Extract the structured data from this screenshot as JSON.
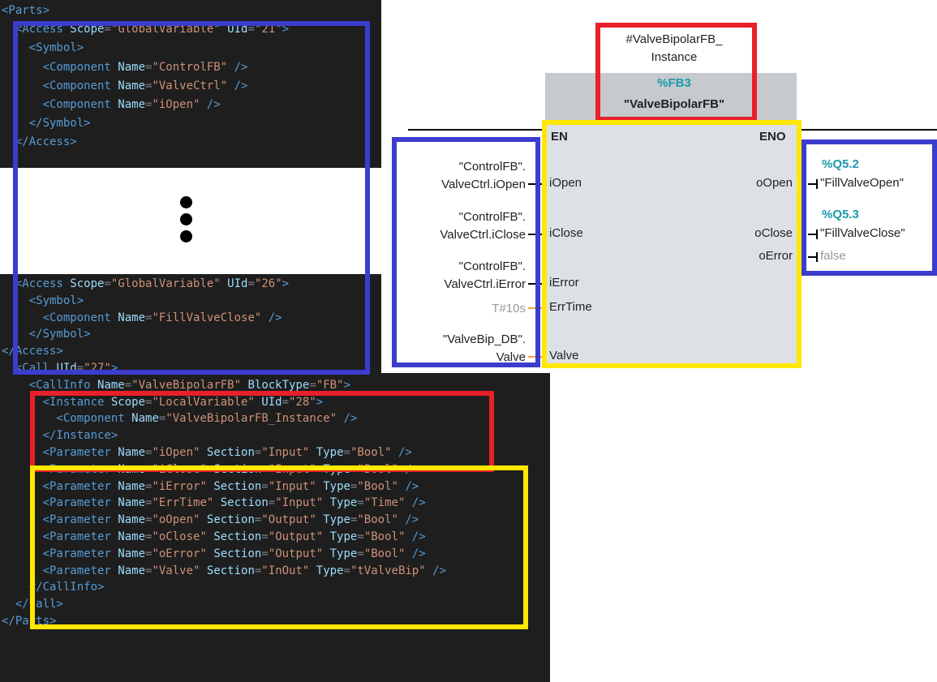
{
  "xml_top": {
    "lines": [
      [
        {
          "c": "t",
          "v": "<Parts>"
        }
      ],
      [
        {
          "c": "t",
          "v": "  <Access "
        },
        {
          "c": "a",
          "v": "Scope"
        },
        {
          "c": "p",
          "v": "="
        },
        {
          "c": "s",
          "v": "\"GlobalVariable\""
        },
        {
          "c": "a",
          "v": " UId"
        },
        {
          "c": "p",
          "v": "="
        },
        {
          "c": "s",
          "v": "\"21\""
        },
        {
          "c": "t",
          "v": ">"
        }
      ],
      [
        {
          "c": "t",
          "v": "    <Symbol>"
        }
      ],
      [
        {
          "c": "t",
          "v": "      <Component "
        },
        {
          "c": "a",
          "v": "Name"
        },
        {
          "c": "p",
          "v": "="
        },
        {
          "c": "s",
          "v": "\"ControlFB\""
        },
        {
          "c": "t",
          "v": " />"
        }
      ],
      [
        {
          "c": "t",
          "v": "      <Component "
        },
        {
          "c": "a",
          "v": "Name"
        },
        {
          "c": "p",
          "v": "="
        },
        {
          "c": "s",
          "v": "\"ValveCtrl\""
        },
        {
          "c": "t",
          "v": " />"
        }
      ],
      [
        {
          "c": "t",
          "v": "      <Component "
        },
        {
          "c": "a",
          "v": "Name"
        },
        {
          "c": "p",
          "v": "="
        },
        {
          "c": "s",
          "v": "\"iOpen\""
        },
        {
          "c": "t",
          "v": " />"
        }
      ],
      [
        {
          "c": "t",
          "v": "    </Symbol>"
        }
      ],
      [
        {
          "c": "t",
          "v": "  </Access>"
        }
      ]
    ]
  },
  "xml_bottom": {
    "lines": [
      [
        {
          "c": "t",
          "v": "  <Access "
        },
        {
          "c": "a",
          "v": "Scope"
        },
        {
          "c": "p",
          "v": "="
        },
        {
          "c": "s",
          "v": "\"GlobalVariable\""
        },
        {
          "c": "a",
          "v": " UId"
        },
        {
          "c": "p",
          "v": "="
        },
        {
          "c": "s",
          "v": "\"26\""
        },
        {
          "c": "t",
          "v": ">"
        }
      ],
      [
        {
          "c": "t",
          "v": "    <Symbol>"
        }
      ],
      [
        {
          "c": "t",
          "v": "      <Component "
        },
        {
          "c": "a",
          "v": "Name"
        },
        {
          "c": "p",
          "v": "="
        },
        {
          "c": "s",
          "v": "\"FillValveClose\""
        },
        {
          "c": "t",
          "v": " />"
        }
      ],
      [
        {
          "c": "t",
          "v": "    </Symbol>"
        }
      ],
      [
        {
          "c": "t",
          "v": "</Access>"
        }
      ],
      [
        {
          "c": "t",
          "v": "  <Call "
        },
        {
          "c": "a",
          "v": "UId"
        },
        {
          "c": "p",
          "v": "="
        },
        {
          "c": "s",
          "v": "\"27\""
        },
        {
          "c": "t",
          "v": ">"
        }
      ],
      [
        {
          "c": "t",
          "v": "    <CallInfo "
        },
        {
          "c": "a",
          "v": "Name"
        },
        {
          "c": "p",
          "v": "="
        },
        {
          "c": "s",
          "v": "\"ValveBipolarFB\""
        },
        {
          "c": "a",
          "v": " BlockType"
        },
        {
          "c": "p",
          "v": "="
        },
        {
          "c": "s",
          "v": "\"FB\""
        },
        {
          "c": "t",
          "v": ">"
        }
      ],
      [
        {
          "c": "t",
          "v": "      <Instance "
        },
        {
          "c": "a",
          "v": "Scope"
        },
        {
          "c": "p",
          "v": "="
        },
        {
          "c": "s",
          "v": "\"LocalVariable\""
        },
        {
          "c": "a",
          "v": " UId"
        },
        {
          "c": "p",
          "v": "="
        },
        {
          "c": "s",
          "v": "\"28\""
        },
        {
          "c": "t",
          "v": ">"
        }
      ],
      [
        {
          "c": "t",
          "v": "        <Component "
        },
        {
          "c": "a",
          "v": "Name"
        },
        {
          "c": "p",
          "v": "="
        },
        {
          "c": "s",
          "v": "\"ValveBipolarFB_Instance\""
        },
        {
          "c": "t",
          "v": " />"
        }
      ],
      [
        {
          "c": "t",
          "v": "      </Instance>"
        }
      ],
      [
        {
          "c": "t",
          "v": "      <Parameter "
        },
        {
          "c": "a",
          "v": "Name"
        },
        {
          "c": "p",
          "v": "="
        },
        {
          "c": "s",
          "v": "\"iOpen\""
        },
        {
          "c": "a",
          "v": " Section"
        },
        {
          "c": "p",
          "v": "="
        },
        {
          "c": "s",
          "v": "\"Input\""
        },
        {
          "c": "a",
          "v": " Type"
        },
        {
          "c": "p",
          "v": "="
        },
        {
          "c": "s",
          "v": "\"Bool\""
        },
        {
          "c": "t",
          "v": " />"
        }
      ],
      [
        {
          "c": "t",
          "v": "      <Parameter "
        },
        {
          "c": "a",
          "v": "Name"
        },
        {
          "c": "p",
          "v": "="
        },
        {
          "c": "s",
          "v": "\"iClose\""
        },
        {
          "c": "a",
          "v": " Section"
        },
        {
          "c": "p",
          "v": "="
        },
        {
          "c": "s",
          "v": "\"Input\""
        },
        {
          "c": "a",
          "v": " Type"
        },
        {
          "c": "p",
          "v": "="
        },
        {
          "c": "s",
          "v": "\"Bool\""
        },
        {
          "c": "t",
          "v": " />"
        }
      ],
      [
        {
          "c": "t",
          "v": "      <Parameter "
        },
        {
          "c": "a",
          "v": "Name"
        },
        {
          "c": "p",
          "v": "="
        },
        {
          "c": "s",
          "v": "\"iError\""
        },
        {
          "c": "a",
          "v": " Section"
        },
        {
          "c": "p",
          "v": "="
        },
        {
          "c": "s",
          "v": "\"Input\""
        },
        {
          "c": "a",
          "v": " Type"
        },
        {
          "c": "p",
          "v": "="
        },
        {
          "c": "s",
          "v": "\"Bool\""
        },
        {
          "c": "t",
          "v": " />"
        }
      ],
      [
        {
          "c": "t",
          "v": "      <Parameter "
        },
        {
          "c": "a",
          "v": "Name"
        },
        {
          "c": "p",
          "v": "="
        },
        {
          "c": "s",
          "v": "\"ErrTime\""
        },
        {
          "c": "a",
          "v": " Section"
        },
        {
          "c": "p",
          "v": "="
        },
        {
          "c": "s",
          "v": "\"Input\""
        },
        {
          "c": "a",
          "v": " Type"
        },
        {
          "c": "p",
          "v": "="
        },
        {
          "c": "s",
          "v": "\"Time\""
        },
        {
          "c": "t",
          "v": " />"
        }
      ],
      [
        {
          "c": "t",
          "v": "      <Parameter "
        },
        {
          "c": "a",
          "v": "Name"
        },
        {
          "c": "p",
          "v": "="
        },
        {
          "c": "s",
          "v": "\"oOpen\""
        },
        {
          "c": "a",
          "v": " Section"
        },
        {
          "c": "p",
          "v": "="
        },
        {
          "c": "s",
          "v": "\"Output\""
        },
        {
          "c": "a",
          "v": " Type"
        },
        {
          "c": "p",
          "v": "="
        },
        {
          "c": "s",
          "v": "\"Bool\""
        },
        {
          "c": "t",
          "v": " />"
        }
      ],
      [
        {
          "c": "t",
          "v": "      <Parameter "
        },
        {
          "c": "a",
          "v": "Name"
        },
        {
          "c": "p",
          "v": "="
        },
        {
          "c": "s",
          "v": "\"oClose\""
        },
        {
          "c": "a",
          "v": " Section"
        },
        {
          "c": "p",
          "v": "="
        },
        {
          "c": "s",
          "v": "\"Output\""
        },
        {
          "c": "a",
          "v": " Type"
        },
        {
          "c": "p",
          "v": "="
        },
        {
          "c": "s",
          "v": "\"Bool\""
        },
        {
          "c": "t",
          "v": " />"
        }
      ],
      [
        {
          "c": "t",
          "v": "      <Parameter "
        },
        {
          "c": "a",
          "v": "Name"
        },
        {
          "c": "p",
          "v": "="
        },
        {
          "c": "s",
          "v": "\"oError\""
        },
        {
          "c": "a",
          "v": " Section"
        },
        {
          "c": "p",
          "v": "="
        },
        {
          "c": "s",
          "v": "\"Output\""
        },
        {
          "c": "a",
          "v": " Type"
        },
        {
          "c": "p",
          "v": "="
        },
        {
          "c": "s",
          "v": "\"Bool\""
        },
        {
          "c": "t",
          "v": " />"
        }
      ],
      [
        {
          "c": "t",
          "v": "      <Parameter "
        },
        {
          "c": "a",
          "v": "Name"
        },
        {
          "c": "p",
          "v": "="
        },
        {
          "c": "s",
          "v": "\"Valve\""
        },
        {
          "c": "a",
          "v": " Section"
        },
        {
          "c": "p",
          "v": "="
        },
        {
          "c": "s",
          "v": "\"InOut\""
        },
        {
          "c": "a",
          "v": " Type"
        },
        {
          "c": "p",
          "v": "="
        },
        {
          "c": "s",
          "v": "\"tValveBip\""
        },
        {
          "c": "t",
          "v": " />"
        }
      ],
      [
        {
          "c": "t",
          "v": "    </CallInfo>"
        }
      ],
      [
        {
          "c": "t",
          "v": "  </Call>"
        }
      ],
      [
        {
          "c": "t",
          "v": "</Parts>"
        }
      ]
    ]
  },
  "fbd": {
    "instance_name": "#ValveBipolarFB_\nInstance",
    "address": "%FB3",
    "block_name": "\"ValveBipolarFB\"",
    "en": "EN",
    "eno": "ENO",
    "inputs": [
      {
        "pin": "iOpen",
        "arg": "\"ControlFB\".\nValveCtrl.iOpen",
        "wire": "black"
      },
      {
        "pin": "iClose",
        "arg": "\"ControlFB\".\nValveCtrl.iClose",
        "wire": "black"
      },
      {
        "pin": "iError",
        "arg": "\"ControlFB\".\nValveCtrl.iError",
        "wire": "black"
      },
      {
        "pin": "ErrTime",
        "arg": "T#10s",
        "wire": "orange"
      },
      {
        "pin": "Valve",
        "arg": "\"ValveBip_DB\".\nValve",
        "wire": "orange"
      }
    ],
    "outputs": [
      {
        "pin": "oOpen",
        "address": "%Q5.2",
        "tag": "\"FillValveOpen\""
      },
      {
        "pin": "oClose",
        "address": "%Q5.3",
        "tag": "\"FillValveClose\""
      },
      {
        "pin": "oError",
        "address": "",
        "tag": "false"
      }
    ],
    "colors": {
      "address": "#1a9aaa",
      "orange_wire": "#f5a033",
      "block_fill": "#dde1e6",
      "header_fill": "#c6c9ce"
    }
  },
  "highlight_colors": {
    "blue": "#3c3ccf",
    "red": "#e8202a",
    "yellow": "#ffe800"
  }
}
